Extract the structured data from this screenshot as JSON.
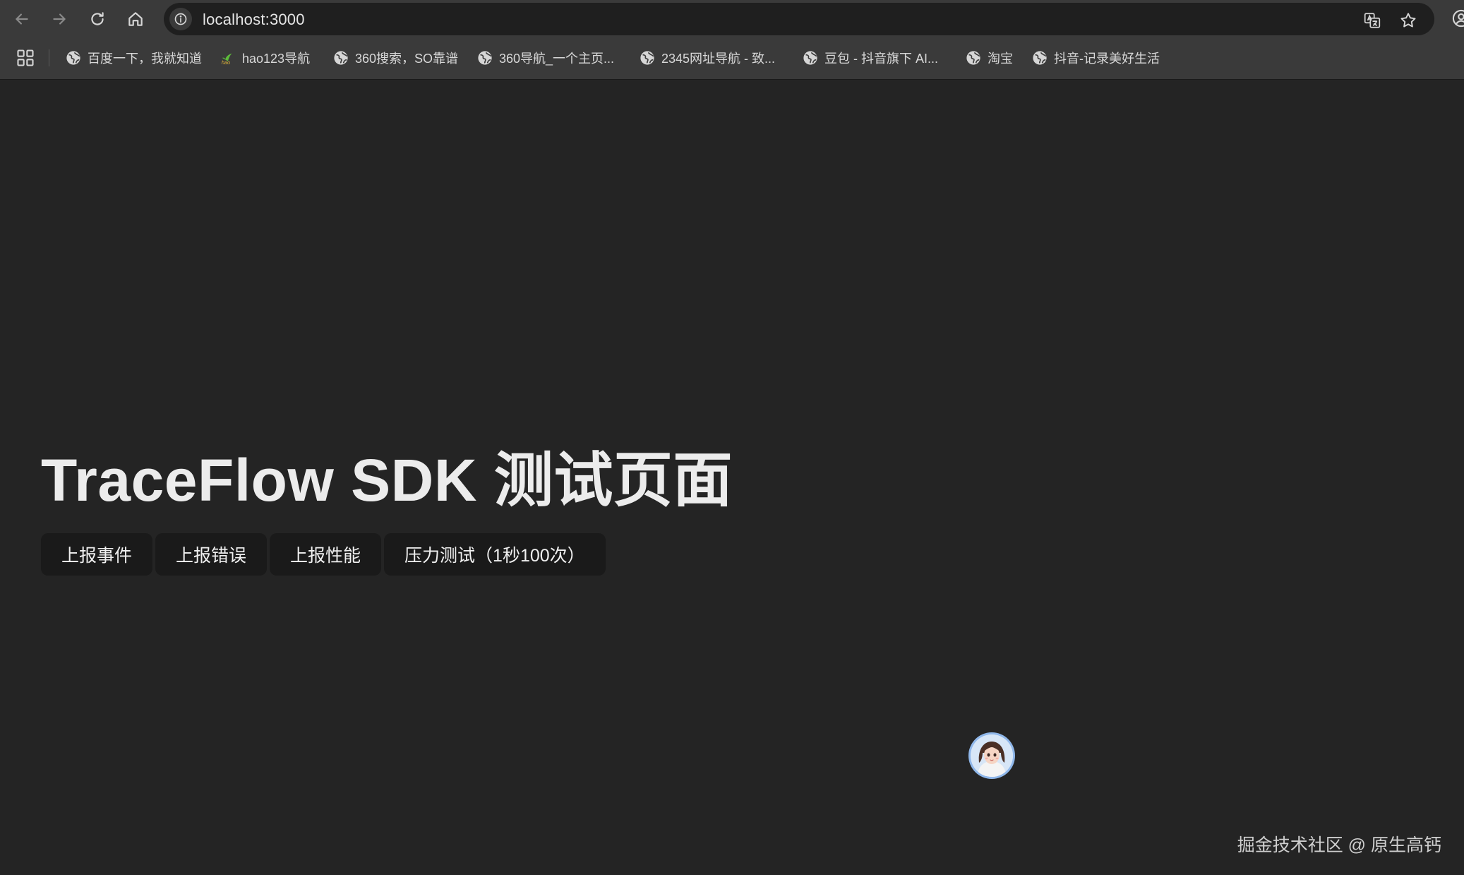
{
  "browser": {
    "url": "localhost:3000",
    "bookmarks": [
      {
        "label": "百度一下，我就知道",
        "icon": "globe-icon"
      },
      {
        "label": "hao123导航",
        "icon": "hao123-icon"
      },
      {
        "label": "360搜索，SO靠谱",
        "icon": "globe-icon"
      },
      {
        "label": "360导航_一个主页...",
        "icon": "globe-icon"
      },
      {
        "label": "2345网址导航 - 致...",
        "icon": "globe-icon"
      },
      {
        "label": "豆包 - 抖音旗下 AI...",
        "icon": "globe-icon"
      },
      {
        "label": "淘宝",
        "icon": "globe-icon"
      },
      {
        "label": "抖音-记录美好生活",
        "icon": "globe-icon"
      }
    ]
  },
  "page": {
    "title": "TraceFlow SDK 测试页面",
    "buttons": [
      {
        "label": "上报事件"
      },
      {
        "label": "上报错误"
      },
      {
        "label": "上报性能"
      },
      {
        "label": "压力测试（1秒100次）"
      }
    ]
  },
  "watermark": "掘金技术社区 @ 原生高钙",
  "colors": {
    "page_background": "#242424",
    "button_background": "#1a1a1a",
    "chrome_background": "#3a3a3a"
  }
}
